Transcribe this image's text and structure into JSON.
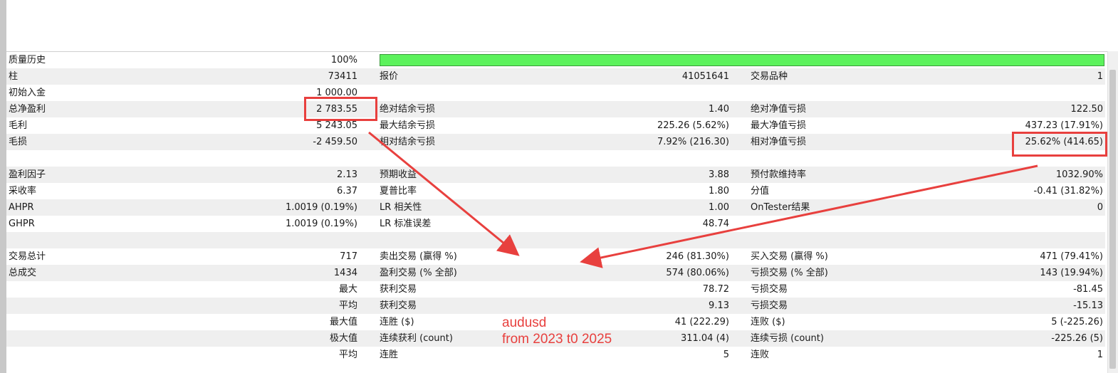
{
  "history_quality": {
    "label": "质量历史",
    "value": "100%"
  },
  "rows": [
    {
      "l1": "柱",
      "v1": "73411",
      "l2": "报价",
      "v2": "41051641",
      "l3": "交易品种",
      "v3": "1"
    },
    {
      "l1": "初始入金",
      "v1": "1 000.00",
      "l2": "",
      "v2": "",
      "l3": "",
      "v3": ""
    },
    {
      "l1": "总净盈利",
      "v1": "2 783.55",
      "l2": "绝对结余亏损",
      "v2": "1.40",
      "l3": "绝对净值亏损",
      "v3": "122.50"
    },
    {
      "l1": "毛利",
      "v1": "5 243.05",
      "l2": "最大结余亏损",
      "v2": "225.26 (5.62%)",
      "l3": "最大净值亏损",
      "v3": "437.23 (17.91%)"
    },
    {
      "l1": "毛损",
      "v1": "-2 459.50",
      "l2": "相对结余亏损",
      "v2": "7.92% (216.30)",
      "l3": "相对净值亏损",
      "v3": "25.62% (414.65)"
    },
    {
      "l1": "",
      "v1": "",
      "l2": "",
      "v2": "",
      "l3": "",
      "v3": ""
    },
    {
      "l1": "盈利因子",
      "v1": "2.13",
      "l2": "预期收益",
      "v2": "3.88",
      "l3": "预付款维持率",
      "v3": "1032.90%"
    },
    {
      "l1": "采收率",
      "v1": "6.37",
      "l2": "夏普比率",
      "v2": "1.80",
      "l3": "分值",
      "v3": "-0.41 (31.82%)"
    },
    {
      "l1": "AHPR",
      "v1": "1.0019 (0.19%)",
      "l2": "LR 相关性",
      "v2": "1.00",
      "l3": "OnTester结果",
      "v3": "0"
    },
    {
      "l1": "GHPR",
      "v1": "1.0019 (0.19%)",
      "l2": "LR 标准误差",
      "v2": "48.74",
      "l3": "",
      "v3": ""
    },
    {
      "l1": "",
      "v1": "",
      "l2": "",
      "v2": "",
      "l3": "",
      "v3": ""
    },
    {
      "l1": "交易总计",
      "v1": "717",
      "l2": "卖出交易 (赢得 %)",
      "v2": "246 (81.30%)",
      "l3": "买入交易 (赢得 %)",
      "v3": "471 (79.41%)"
    },
    {
      "l1": "总成交",
      "v1": "1434",
      "l2": "盈利交易 (% 全部)",
      "v2": "574 (80.06%)",
      "l3": "亏损交易 (% 全部)",
      "v3": "143 (19.94%)"
    },
    {
      "l1": "",
      "v1": "最大",
      "l2": "获利交易",
      "v2": "78.72",
      "l3": "亏损交易",
      "v3": "-81.45"
    },
    {
      "l1": "",
      "v1": "平均",
      "l2": "获利交易",
      "v2": "9.13",
      "l3": "亏损交易",
      "v3": "-15.13"
    },
    {
      "l1": "",
      "v1": "最大值",
      "l2": "连胜 ($)",
      "v2": "41 (222.29)",
      "l3": "连败 ($)",
      "v3": "5 (-225.26)"
    },
    {
      "l1": "",
      "v1": "极大值",
      "l2": "连续获利 (count)",
      "v2": "311.04 (4)",
      "l3": "连续亏损 (count)",
      "v3": "-225.26 (5)"
    },
    {
      "l1": "",
      "v1": "平均",
      "l2": "连胜",
      "v2": "5",
      "l3": "连败",
      "v3": "1"
    }
  ],
  "annotation": {
    "line1": "audusd",
    "line2": "from 2023  t0 2025"
  },
  "colors": {
    "accent": "#e8403e",
    "bar": "#5cf25c",
    "shade": "#efefef"
  }
}
